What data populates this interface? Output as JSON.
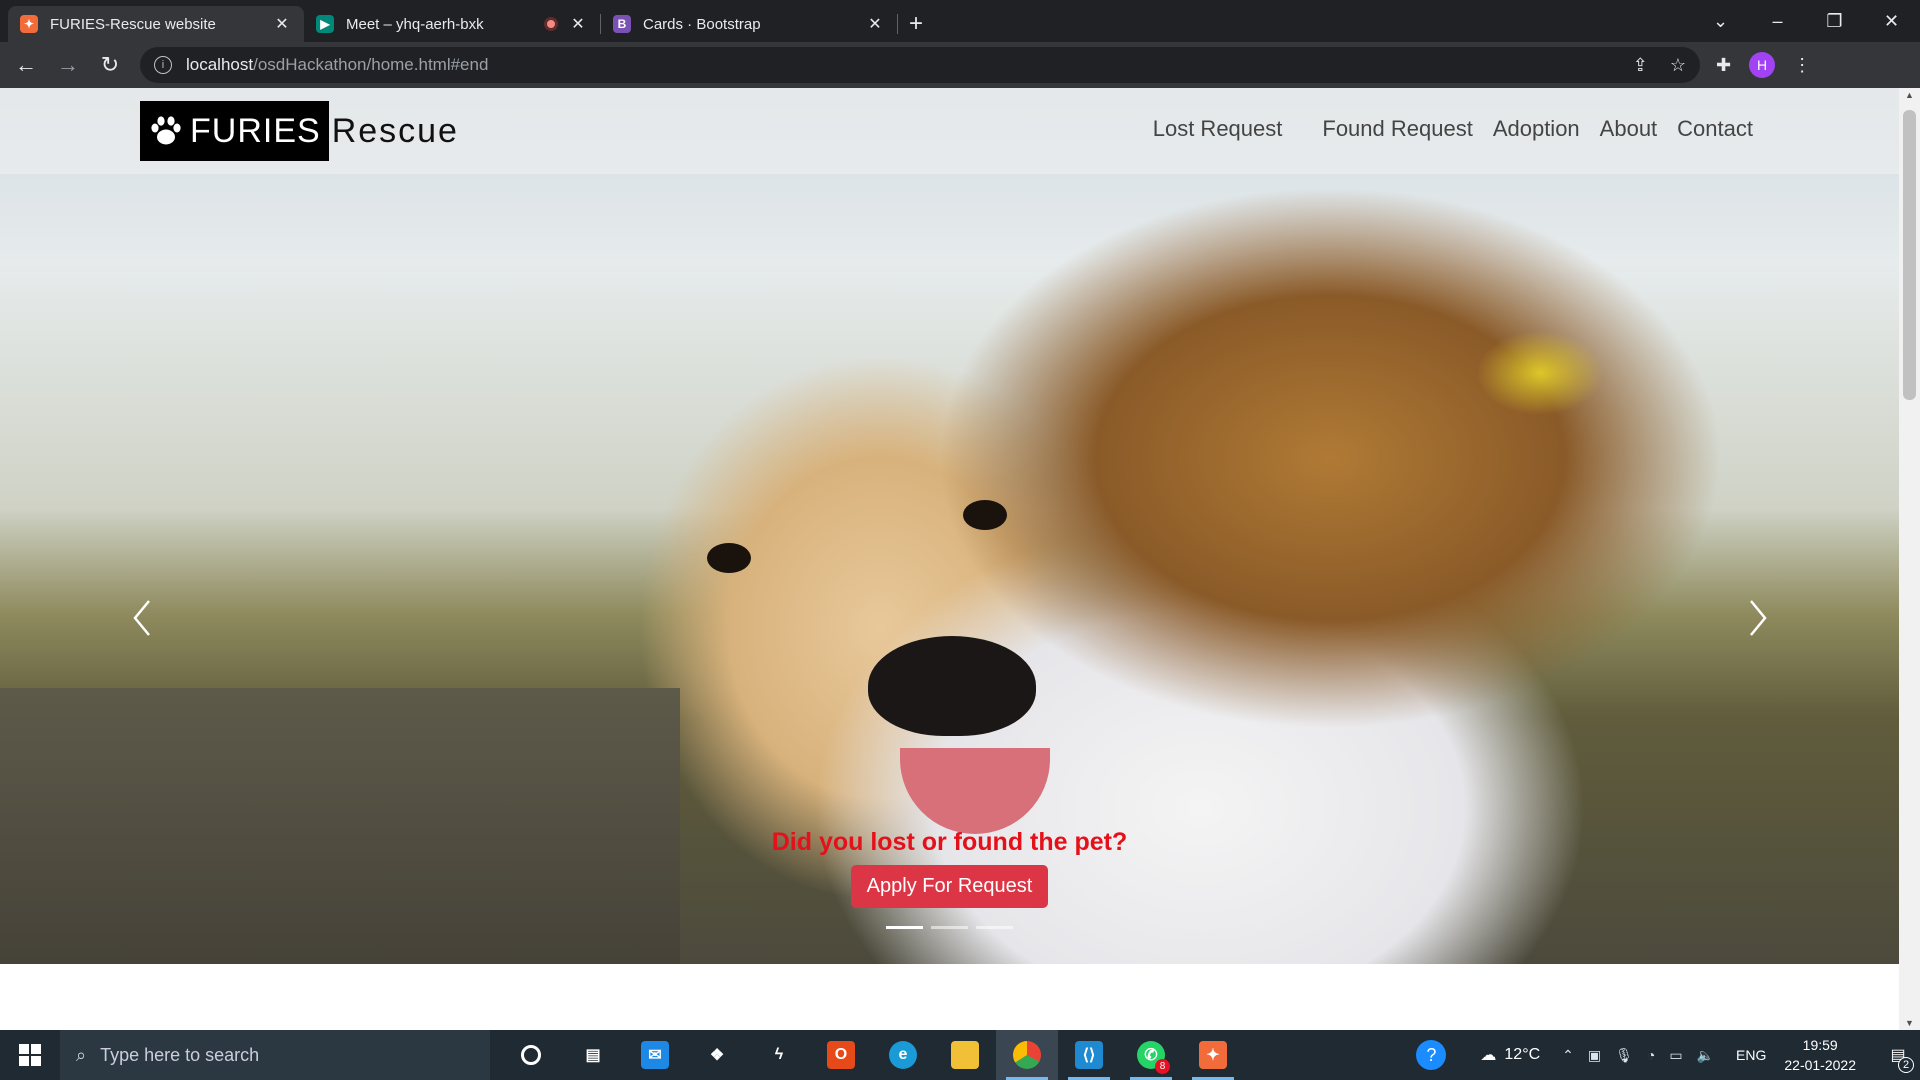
{
  "browser": {
    "tabs": [
      {
        "title": "FURIES-Rescue website",
        "favicon_color": "#f26b3a",
        "favicon_glyph": "⌘"
      },
      {
        "title": "Meet – yhq-aerh-bxk",
        "favicon_color": "#00897b",
        "favicon_glyph": "▶"
      },
      {
        "title": "Cards · Bootstrap",
        "favicon_color": "#7952b3",
        "favicon_glyph": "B"
      }
    ],
    "url_host": "localhost",
    "url_path": "/osdHackathon/home.html#end",
    "profile_initial": "H"
  },
  "site": {
    "brand_primary": "FURIES",
    "brand_secondary": "Rescue",
    "nav": [
      "Lost Request",
      "Found Request",
      "Adoption",
      "About",
      "Contact"
    ],
    "hero": {
      "caption_title": "Did you lost or found the pet?",
      "cta_label": "Apply For Request",
      "slides": 3,
      "active_slide": 1
    },
    "colors": {
      "cta": "#dc3545",
      "caption": "#e4101a"
    }
  },
  "taskbar": {
    "search_placeholder": "Type here to search",
    "temperature": "12°C",
    "language": "ENG",
    "time": "19:59",
    "date": "22-01-2022",
    "whatsapp_badge": "8",
    "notifications": "2"
  }
}
